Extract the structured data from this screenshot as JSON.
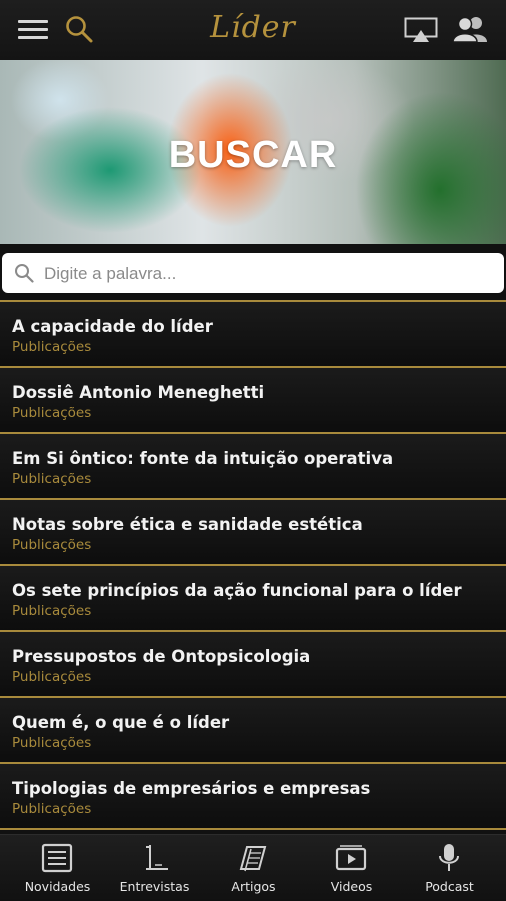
{
  "header": {
    "logo": "Líder",
    "menu_icon": "hamburger-menu-icon",
    "search_icon": "search-icon",
    "airplay_icon": "airplay-icon",
    "users_icon": "users-icon"
  },
  "hero": {
    "title": "BUSCAR"
  },
  "search": {
    "placeholder": "Digite a palavra...",
    "value": ""
  },
  "results": [
    {
      "title": "A capacidade do líder",
      "category": "Publicações"
    },
    {
      "title": "Dossiê Antonio Meneghetti",
      "category": "Publicações"
    },
    {
      "title": "Em Si ôntico: fonte da intuição operativa",
      "category": "Publicações"
    },
    {
      "title": "Notas sobre ética e sanidade estética",
      "category": "Publicações"
    },
    {
      "title": "Os sete princípios da ação funcional para o líder",
      "category": "Publicações"
    },
    {
      "title": "Pressupostos de Ontopsicologia",
      "category": "Publicações"
    },
    {
      "title": "Quem é, o que é o líder",
      "category": "Publicações"
    },
    {
      "title": "Tipologias de empresários e empresas",
      "category": "Publicações"
    }
  ],
  "tabs": [
    {
      "label": "Novidades",
      "icon": "news-icon"
    },
    {
      "label": "Entrevistas",
      "icon": "interview-icon"
    },
    {
      "label": "Artigos",
      "icon": "articles-icon"
    },
    {
      "label": "Videos",
      "icon": "video-icon"
    },
    {
      "label": "Podcast",
      "icon": "microphone-icon"
    }
  ],
  "colors": {
    "accent": "#a88a3c",
    "background": "#111111",
    "text": "#f2f2f2"
  }
}
